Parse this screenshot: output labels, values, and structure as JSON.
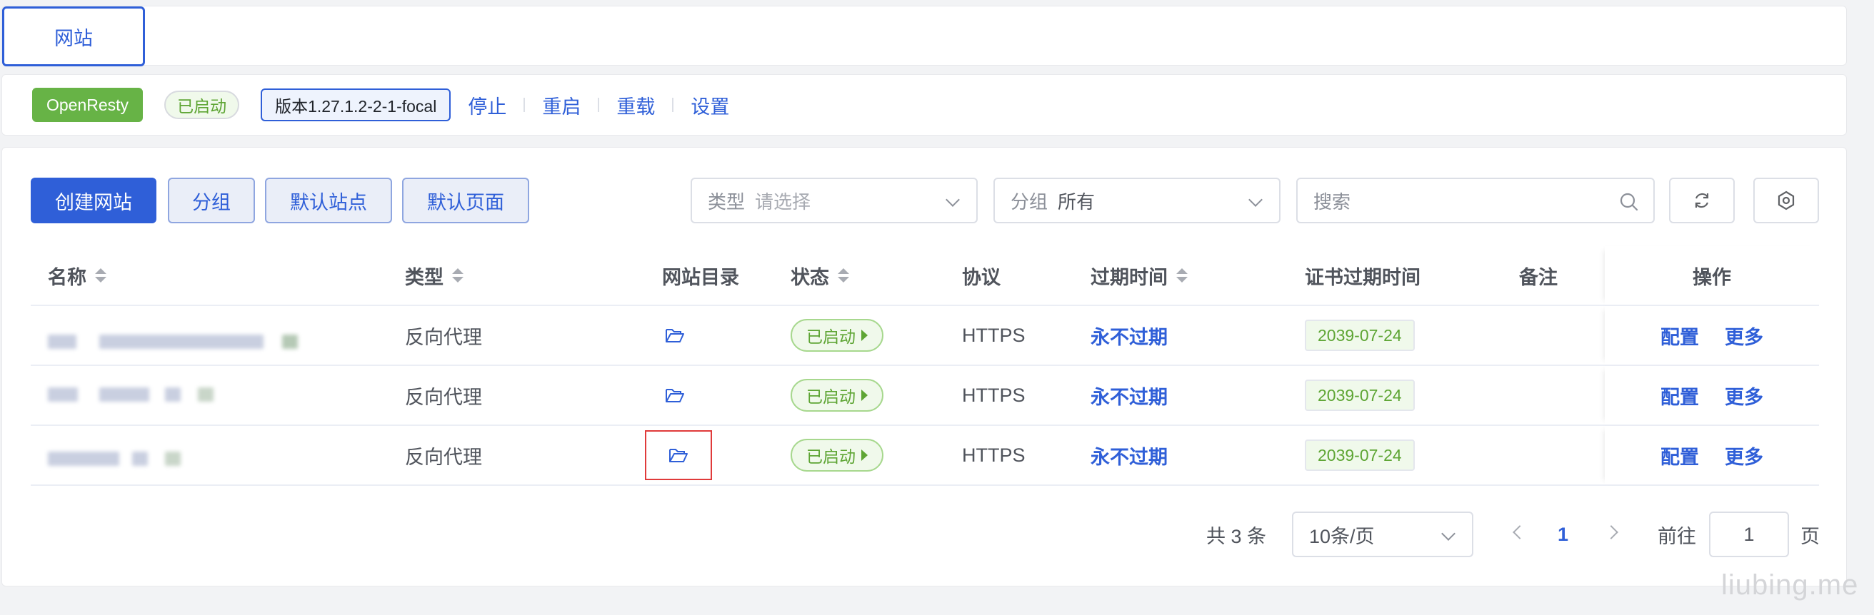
{
  "tabs": {
    "active": "网站"
  },
  "statusbar": {
    "app_name": "OpenResty",
    "run_status": "已启动",
    "version": "版本1.27.1.2-2-1-focal",
    "actions": [
      "停止",
      "重启",
      "重载",
      "设置"
    ]
  },
  "toolbar": {
    "create_label": "创建网站",
    "group_label": "分组",
    "default_site_label": "默认站点",
    "default_page_label": "默认页面",
    "type_filter": {
      "label": "类型",
      "placeholder": "请选择"
    },
    "group_filter": {
      "label": "分组",
      "value": "所有"
    },
    "search_placeholder": "搜索",
    "refresh_icon": "refresh-icon",
    "settings_icon": "gear-icon"
  },
  "table": {
    "headers": {
      "name": "名称",
      "type": "类型",
      "dir": "网站目录",
      "status": "状态",
      "protocol": "协议",
      "expire": "过期时间",
      "cert_expire": "证书过期时间",
      "remark": "备注",
      "ops": "操作"
    },
    "rows": [
      {
        "type": "反向代理",
        "status": "已启动",
        "protocol": "HTTPS",
        "expire": "永不过期",
        "cert_expire": "2039-07-24",
        "op_config": "配置",
        "op_more": "更多"
      },
      {
        "type": "反向代理",
        "status": "已启动",
        "protocol": "HTTPS",
        "expire": "永不过期",
        "cert_expire": "2039-07-24",
        "op_config": "配置",
        "op_more": "更多"
      },
      {
        "type": "反向代理",
        "status": "已启动",
        "protocol": "HTTPS",
        "expire": "永不过期",
        "cert_expire": "2039-07-24",
        "op_config": "配置",
        "op_more": "更多"
      }
    ]
  },
  "pagination": {
    "total": "共 3 条",
    "page_size": "10条/页",
    "current_page": "1",
    "goto_label": "前往",
    "goto_value": "1",
    "page_unit": "页"
  },
  "watermark": "liubing.me",
  "colors": {
    "primary": "#2f5fd8",
    "success": "#67b346",
    "highlight": "#e03a3a"
  }
}
